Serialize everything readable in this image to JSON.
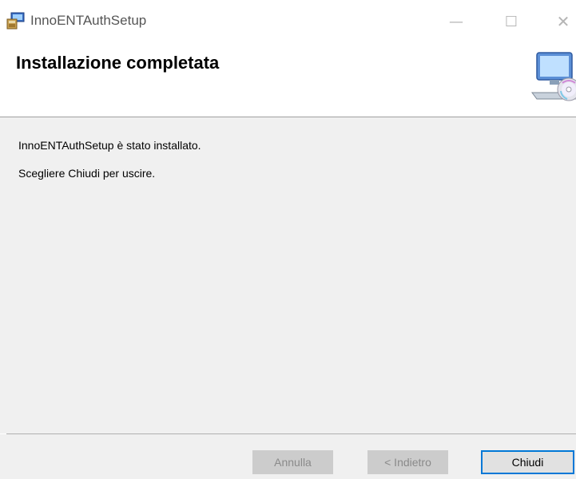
{
  "window": {
    "title": "InnoENTAuthSetup",
    "controls": {
      "minimize": "—",
      "maximize": "☐",
      "close": "✕"
    }
  },
  "header": {
    "heading": "Installazione completata",
    "icon": "computer-cd-setup-icon"
  },
  "content": {
    "message": "InnoENTAuthSetup è stato installato.",
    "instruction": "Scegliere Chiudi per uscire."
  },
  "buttons": {
    "cancel": "Annulla",
    "back": "< Indietro",
    "close": "Chiudi"
  },
  "colors": {
    "accent": "#0078d7",
    "content_bg": "#f0f0f0",
    "disabled_bg": "#cccccc"
  }
}
